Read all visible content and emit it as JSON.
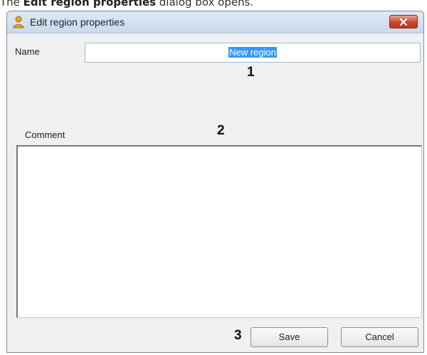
{
  "doc": {
    "prefix": "The ",
    "bold": "Edit region properties",
    "suffix": " dialog box opens."
  },
  "window": {
    "title": "Edit region properties",
    "icon": "user-icon",
    "close_icon": "close-icon"
  },
  "form": {
    "name_label": "Name",
    "name_value": "New region",
    "comment_label": "Comment",
    "comment_value": ""
  },
  "markers": {
    "m1": "1",
    "m2": "2",
    "m3": "3"
  },
  "buttons": {
    "save": "Save",
    "cancel": "Cancel"
  },
  "colors": {
    "selection": "#3399ff",
    "close_button": "#c9462c",
    "window_bg": "#f0f0f0",
    "titlebar": "#c9d9ec"
  }
}
